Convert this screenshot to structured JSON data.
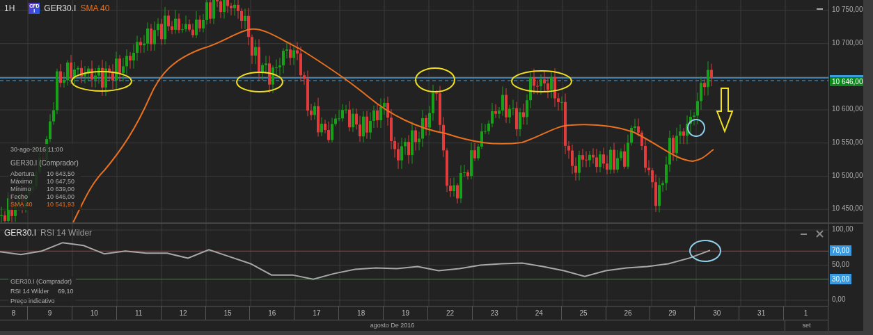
{
  "header": {
    "timeframe": "1H",
    "badge": "CFD",
    "badge_sub": "I",
    "symbol": "GER30.I",
    "indicator": "SMA 40"
  },
  "price_axis": {
    "ticks": [
      "10 750,00",
      "10 700,00",
      "10 600,00",
      "10 550,00",
      "10 500,00",
      "10 450,00"
    ],
    "current_price": "10 646,00"
  },
  "info_panel": {
    "datetime": "30-ago-2016 11:00",
    "title": "GER30.I (Comprador)",
    "rows": [
      {
        "label": "Abertura",
        "value": "10 643,50",
        "kind": "price"
      },
      {
        "label": "Máximo",
        "value": "10 647,50",
        "kind": "price"
      },
      {
        "label": "Mínimo",
        "value": "10 639,00",
        "kind": "price"
      },
      {
        "label": "Fecho",
        "value": "10 646,00",
        "kind": "price"
      },
      {
        "label": "SMA 40",
        "value": "10 541,93",
        "kind": "indicator"
      }
    ]
  },
  "rsi_panel": {
    "symbol": "GER30.I",
    "chart_data": {
      "type": "line",
      "grid": true,
      "ylim": [
        0,
        100
      ],
      "ref_lines": [
        {
          "axis": "y",
          "value": 70,
          "label": "70,00",
          "color": "#c83232"
        },
        {
          "axis": "y",
          "value": 30,
          "label": "30,00",
          "color": "#22a022"
        }
      ],
      "yticks": [
        {
          "value": 100,
          "label": "100,00"
        },
        {
          "value": 50,
          "label": "50,00"
        },
        {
          "value": 0,
          "label": "0,00"
        }
      ],
      "series": [
        {
          "name": "RSI 14 Wilder",
          "color": "#a8a8a8",
          "values": [
            69,
            65,
            70,
            82,
            78,
            66,
            70,
            67,
            67,
            60,
            72,
            62,
            52,
            36,
            36,
            30,
            38,
            44,
            46,
            45,
            48,
            42,
            45,
            50,
            52,
            53,
            48,
            42,
            34,
            42,
            46,
            48,
            52,
            60,
            71
          ]
        }
      ]
    },
    "info_title": "GER30.I (Comprador)",
    "info_label": "RSI 14 Wilder",
    "info_value": "69,10",
    "note": "Preço indicativo"
  },
  "date_axis": {
    "days": [
      "8",
      "9",
      "10",
      "11",
      "12",
      "15",
      "16",
      "17",
      "18",
      "19",
      "22",
      "23",
      "24",
      "25",
      "26",
      "29",
      "30",
      "31",
      "1"
    ],
    "months": [
      "agosto De 2016",
      "set"
    ]
  }
}
